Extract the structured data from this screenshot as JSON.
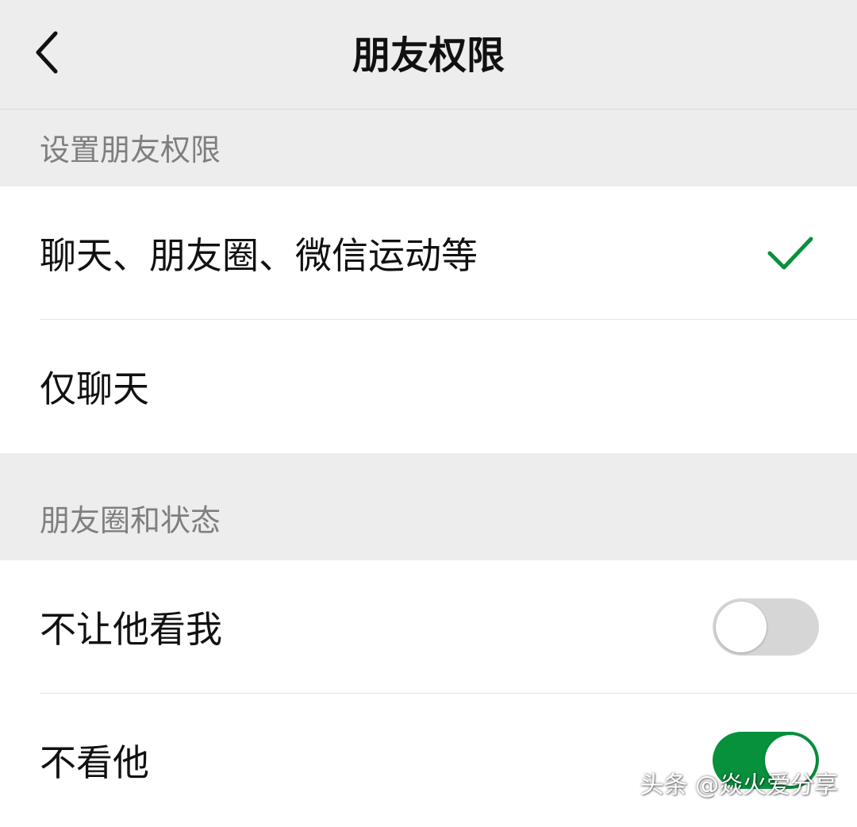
{
  "navbar": {
    "title": "朋友权限",
    "back_icon": "chevron-left-icon"
  },
  "sections": {
    "permissions_header": "设置朋友权限",
    "moments_header": "朋友圈和状态"
  },
  "permissions": {
    "option_full": "聊天、朋友圈、微信运动等",
    "option_chat_only": "仅聊天",
    "selected": "option_full",
    "check_icon": "check-icon"
  },
  "moments": {
    "hide_my_posts_label": "不让他看我",
    "hide_my_posts_on": false,
    "hide_his_posts_label": "不看他",
    "hide_his_posts_on": true
  },
  "colors": {
    "accent": "#07913c",
    "toggle_off": "#d6d6d6",
    "background": "#ededed",
    "section_text": "#7f7f7f"
  },
  "watermark": "头条 @焱火爱分享"
}
